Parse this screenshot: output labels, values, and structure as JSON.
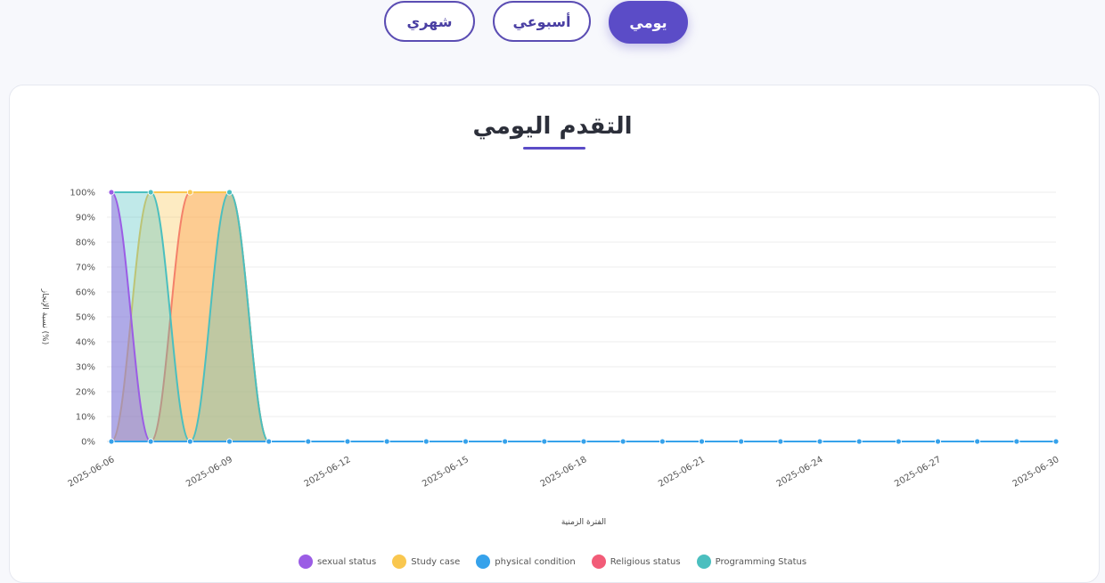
{
  "tabs": [
    {
      "label": "شهري",
      "active": false
    },
    {
      "label": "أسبوعي",
      "active": false
    },
    {
      "label": "يومي",
      "active": true
    }
  ],
  "chart_data": {
    "type": "area",
    "title": "التقدم اليومي",
    "xlabel": "الفترة الزمنية",
    "ylabel": "نسبة الإنجاز (%)",
    "ylim": [
      0,
      100
    ],
    "yticks": [
      0,
      10,
      20,
      30,
      40,
      50,
      60,
      70,
      80,
      90,
      100
    ],
    "ytick_suffix": "%",
    "x": [
      "2025-06-06",
      "2025-06-07",
      "2025-06-08",
      "2025-06-09",
      "2025-06-10",
      "2025-06-11",
      "2025-06-12",
      "2025-06-13",
      "2025-06-14",
      "2025-06-15",
      "2025-06-16",
      "2025-06-17",
      "2025-06-18",
      "2025-06-19",
      "2025-06-20",
      "2025-06-21",
      "2025-06-22",
      "2025-06-23",
      "2025-06-24",
      "2025-06-25",
      "2025-06-26",
      "2025-06-27",
      "2025-06-28",
      "2025-06-29",
      "2025-06-30"
    ],
    "xtick_labels": [
      "2025-06-06",
      "2025-06-09",
      "2025-06-12",
      "2025-06-15",
      "2025-06-18",
      "2025-06-21",
      "2025-06-24",
      "2025-06-27",
      "2025-06-30"
    ],
    "grid": true,
    "legend_position": "bottom",
    "series": [
      {
        "name": "sexual status",
        "color": "#9b5de5",
        "fill": "rgba(155,93,229,0.45)",
        "values": [
          100,
          0,
          0,
          0,
          0,
          0,
          0,
          0,
          0,
          0,
          0,
          0,
          0,
          0,
          0,
          0,
          0,
          0,
          0,
          0,
          0,
          0,
          0,
          0,
          0
        ]
      },
      {
        "name": "Study case",
        "color": "#f9c74f",
        "fill": "rgba(249,199,79,0.35)",
        "values": [
          0,
          100,
          100,
          100,
          0,
          0,
          0,
          0,
          0,
          0,
          0,
          0,
          0,
          0,
          0,
          0,
          0,
          0,
          0,
          0,
          0,
          0,
          0,
          0,
          0
        ]
      },
      {
        "name": "physical condition",
        "color": "#36a2eb",
        "fill": "rgba(54,162,235,0.25)",
        "values": [
          0,
          0,
          0,
          0,
          0,
          0,
          0,
          0,
          0,
          0,
          0,
          0,
          0,
          0,
          0,
          0,
          0,
          0,
          0,
          0,
          0,
          0,
          0,
          0,
          0
        ]
      },
      {
        "name": "Religious status",
        "color": "#f25c78",
        "fill": "rgba(255,150,90,0.45)",
        "values": [
          0,
          0,
          100,
          100,
          0,
          0,
          0,
          0,
          0,
          0,
          0,
          0,
          0,
          0,
          0,
          0,
          0,
          0,
          0,
          0,
          0,
          0,
          0,
          0,
          0
        ]
      },
      {
        "name": "Programming Status",
        "color": "#4bbfbf",
        "fill": "rgba(75,191,191,0.35)",
        "values": [
          100,
          100,
          0,
          100,
          0,
          0,
          0,
          0,
          0,
          0,
          0,
          0,
          0,
          0,
          0,
          0,
          0,
          0,
          0,
          0,
          0,
          0,
          0,
          0,
          0
        ]
      }
    ]
  }
}
